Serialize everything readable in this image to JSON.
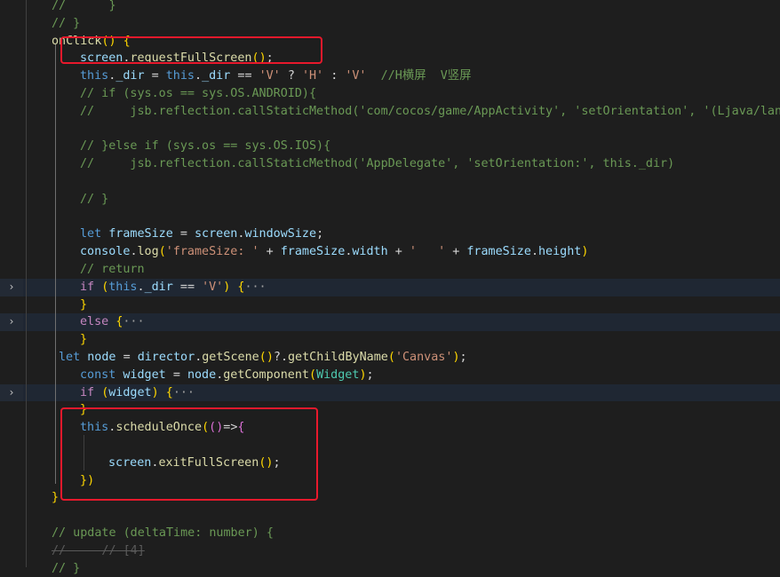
{
  "editor": {
    "lines": [
      {
        "t": "//      }"
      },
      {
        "t": "// }"
      },
      {
        "t": "onClick() {"
      },
      {
        "t": "screen.requestFullScreen();"
      },
      {
        "t": "this._dir = this._dir == 'V' ? 'H' : 'V'  //H横屏  V竖屏"
      },
      {
        "t": "// if (sys.os == sys.OS.ANDROID){"
      },
      {
        "t": "//     jsb.reflection.callStaticMethod('com/cocos/game/AppActivity', 'setOrientation', '(Ljava/lang"
      },
      {
        "t": ""
      },
      {
        "t": "// }else if (sys.os == sys.OS.IOS){"
      },
      {
        "t": "//     jsb.reflection.callStaticMethod('AppDelegate', 'setOrientation:', this._dir)"
      },
      {
        "t": ""
      },
      {
        "t": "// }"
      },
      {
        "t": ""
      },
      {
        "t": "let frameSize = screen.windowSize;"
      },
      {
        "t": "console.log('frameSize: ' + frameSize.width + '   ' + frameSize.height)"
      },
      {
        "t": "// return"
      },
      {
        "t": "if (this._dir == 'V') {···"
      },
      {
        "t": "}"
      },
      {
        "t": "else {···"
      },
      {
        "t": "}"
      },
      {
        "t": "let node = director.getScene()?.getChildByName('Canvas');"
      },
      {
        "t": "const widget = node.getComponent(Widget);"
      },
      {
        "t": "if (widget) {···"
      },
      {
        "t": "}"
      },
      {
        "t": "this.scheduleOnce(()=>{"
      },
      {
        "t": ""
      },
      {
        "t": "screen.exitFullScreen();"
      },
      {
        "t": "})"
      },
      {
        "t": "}"
      },
      {
        "t": ""
      },
      {
        "t": "// update (deltaTime: number) {"
      },
      {
        "t": "//     // [4]"
      },
      {
        "t": "// }"
      }
    ],
    "fold_glyph": "›",
    "annotation_color": "#e8192c",
    "folded_lines": [
      17,
      19,
      23
    ]
  }
}
